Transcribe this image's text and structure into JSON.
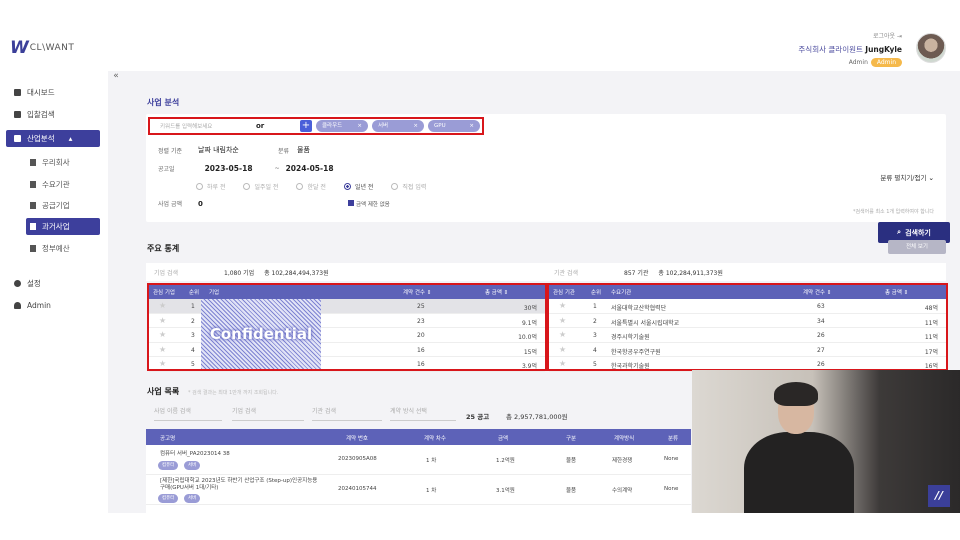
{
  "app": {
    "logo_text": "CL\\WANT"
  },
  "header": {
    "logout": "로그아웃",
    "company": "주식회사 클라이원트",
    "user": "JungKyle",
    "role": "Admin",
    "badge": "Admin"
  },
  "sidebar": {
    "collapse": "«",
    "items": [
      {
        "label": "대시보드"
      },
      {
        "label": "입찰검색"
      },
      {
        "label": "산업분석"
      },
      {
        "label": "설정"
      },
      {
        "label": "Admin"
      }
    ],
    "sub": [
      {
        "label": "우리회사"
      },
      {
        "label": "수요기관"
      },
      {
        "label": "공급기업"
      },
      {
        "label": "과거사업"
      },
      {
        "label": "정부예산"
      }
    ]
  },
  "page_title": "사업 분석",
  "search": {
    "keyword_placeholder": "키워드를 입력해보세요",
    "operator": "or",
    "chips": [
      "클라우드",
      "서버",
      "GPU"
    ],
    "sort_label": "정렬 기준",
    "sort_value": "날짜 내림차순",
    "category_label": "분류",
    "category_value": "물품",
    "date_label": "공고일",
    "date_from": "2023-05-18",
    "date_to": "2024-05-18",
    "periods": [
      "하루 전",
      "일주일 전",
      "한달 전",
      "일년 전",
      "직접 입력"
    ],
    "amount_label": "사업 금액",
    "amount_value": "0",
    "amount_check": "금액 제한 없음",
    "toggle_category": "분류 펼치기/접기",
    "hint": "*검색어를 최소 1개 입력하여야 합니다",
    "search_button": "검색하기"
  },
  "stats": {
    "title": "주요 통계",
    "view_all": "전체 보기",
    "company_summary": {
      "label": "기업 검색",
      "count": "1,080 기업",
      "total": "총 102,284,494,373원"
    },
    "agency_summary": {
      "label": "기관 검색",
      "count": "857 기관",
      "total": "총 102,284,911,373원"
    },
    "company_headers": [
      "관심 기업",
      "순위",
      "기업",
      "계약 건수 ⇕",
      "총 금액 ⇕"
    ],
    "company_rows": [
      {
        "rank": "1",
        "count": "25",
        "amount": "30억"
      },
      {
        "rank": "2",
        "count": "23",
        "amount": "9.1억"
      },
      {
        "rank": "3",
        "count": "20",
        "amount": "10.0억"
      },
      {
        "rank": "4",
        "count": "16",
        "amount": "15억"
      },
      {
        "rank": "5",
        "count": "16",
        "amount": "3.9억"
      }
    ],
    "confidential": "Confidential",
    "agency_headers": [
      "관심 기관",
      "순위",
      "수요기관",
      "계약 건수 ⇕",
      "총 금액 ⇕"
    ],
    "agency_rows": [
      {
        "rank": "1",
        "name": "서울대학교산학협력단",
        "count": "63",
        "amount": "48억"
      },
      {
        "rank": "2",
        "name": "서울특별시 서울시립대학교",
        "count": "34",
        "amount": "11억"
      },
      {
        "rank": "3",
        "name": "경주시학기술원",
        "count": "26",
        "amount": "11억"
      },
      {
        "rank": "4",
        "name": "한국항공우주연구원",
        "count": "27",
        "amount": "17억"
      },
      {
        "rank": "5",
        "name": "한국과학기술원",
        "count": "26",
        "amount": "16억"
      }
    ]
  },
  "list": {
    "title": "사업 목록",
    "hint": "* 검색 결과는 최대 1만개 까지 조회됩니다.",
    "filters": [
      "사업 이름 검색",
      "기업 검색",
      "기관 검색",
      "계약 방식 선택"
    ],
    "count": "25 공고",
    "total": "총 2,957,781,000원",
    "headers": [
      "공고명",
      "계약 번호",
      "계약 차수",
      "금액",
      "구분",
      "계약방식",
      "분류"
    ],
    "rows": [
      {
        "title": "컴퓨터 서버_PA2023014 38",
        "tags": [
          "컴퓨터",
          "서버"
        ],
        "number": "20230905A08",
        "round": "1 차",
        "amount": "1.2억원",
        "type": "물품",
        "method": "제한경쟁",
        "class": "None"
      },
      {
        "title": "[제한]국립대학교 2023년도 하반기 산업구조 (Step-up)인공지능용 구매(GPU서버 1대/기타)",
        "tags": [
          "컴퓨터",
          "서버"
        ],
        "number": "20240105744",
        "round": "1 차",
        "amount": "3.1억원",
        "type": "물품",
        "method": "수의계약",
        "class": "None"
      }
    ]
  },
  "colors": {
    "accent": "#3d3f9c",
    "table_header": "#5d62b8",
    "highlight": "#d8161b",
    "chip": "#9a9cd6",
    "badge": "#f5b94b"
  }
}
